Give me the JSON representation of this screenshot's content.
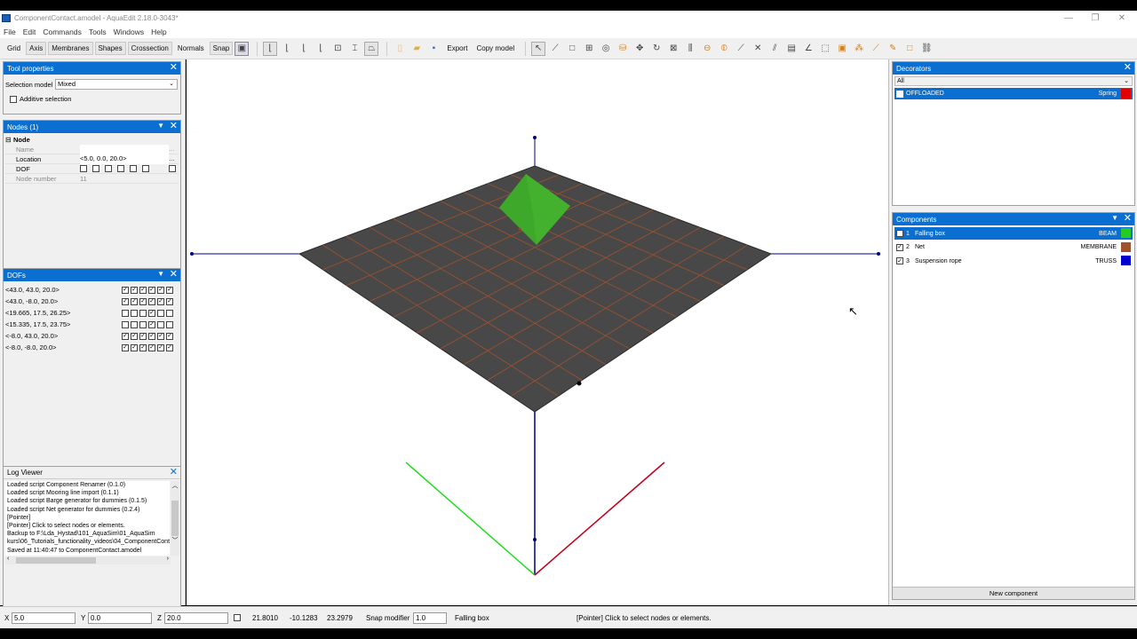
{
  "window": {
    "title": "ComponentContact.amodel - AquaEdit 2.18.0-3043*",
    "min": "—",
    "max": "❐",
    "close": "✕"
  },
  "menu": [
    "File",
    "Edit",
    "Commands",
    "Tools",
    "Windows",
    "Help"
  ],
  "toolbar": {
    "buttons": [
      "Grid",
      "Axis",
      "Membranes",
      "Shapes",
      "Crossection",
      "Normals",
      "Snap"
    ],
    "export": "Export",
    "copy_model": "Copy model"
  },
  "tool_properties": {
    "title": "Tool properties",
    "selection_model_label": "Selection model",
    "selection_model_value": "Mixed",
    "additive_selection": "Additive selection"
  },
  "nodes": {
    "title": "Nodes (1)",
    "group": "Node",
    "rows": [
      {
        "label": "Name",
        "value": ""
      },
      {
        "label": "Location",
        "value": "<5.0, 0.0, 20.0>"
      },
      {
        "label": "DOF",
        "value": ""
      },
      {
        "label": "Node number",
        "value": "11"
      }
    ]
  },
  "dofs": {
    "title": "DOFs",
    "rows": [
      {
        "label": "<43.0, 43.0, 20.0>",
        "checks": [
          true,
          true,
          true,
          true,
          true,
          true
        ]
      },
      {
        "label": "<43.0, -8.0, 20.0>",
        "checks": [
          true,
          true,
          true,
          true,
          true,
          true
        ]
      },
      {
        "label": "<19.665, 17.5, 26.25>",
        "checks": [
          false,
          false,
          false,
          true,
          false,
          false
        ]
      },
      {
        "label": "<15.335, 17.5, 23.75>",
        "checks": [
          false,
          false,
          false,
          true,
          false,
          false
        ]
      },
      {
        "label": "<-8.0, 43.0, 20.0>",
        "checks": [
          true,
          true,
          true,
          true,
          true,
          true
        ]
      },
      {
        "label": "<-8.0, -8.0, 20.0>",
        "checks": [
          true,
          true,
          true,
          true,
          true,
          true
        ]
      }
    ]
  },
  "log_viewer": {
    "title": "Log Viewer",
    "lines": [
      "Loaded script Component Renamer (0.1.0)",
      "Loaded script Mooring line import (0.1.1)",
      "Loaded script Barge generator for dummies (0.1.5)",
      "Loaded script Net generator for dummies (0.2.4)",
      "[Pointer]",
      "[Pointer] Click to select nodes or elements.",
      "Backup to F:\\Lda_Hystad\\101_AquaSim\\01_AquaSim",
      "kurs\\06_Tutorials_functionality_videos\\04_ComponentCont",
      "Saved at 11:40:47 to ComponentContact.amodel"
    ]
  },
  "decorators": {
    "title": "Decorators",
    "filter": "All",
    "items": [
      {
        "name": "OFFLOADED",
        "type": "Spring",
        "color": "#e00000",
        "checked": true
      }
    ]
  },
  "components": {
    "title": "Components",
    "items": [
      {
        "index": "1",
        "name": "Falling box",
        "type": "BEAM",
        "color": "#22cc22",
        "checked": true
      },
      {
        "index": "2",
        "name": "Net",
        "type": "MEMBRANE",
        "color": "#a0522d",
        "checked": true
      },
      {
        "index": "3",
        "name": "Suspension rope",
        "type": "TRUSS",
        "color": "#0000cc",
        "checked": true
      }
    ],
    "new_button": "New component"
  },
  "statusbar": {
    "x_label": "X",
    "x_value": "5.0",
    "y_label": "Y",
    "y_value": "0.0",
    "z_label": "Z",
    "z_value": "20.0",
    "coord1": "21.8010",
    "coord2": "-10.1283",
    "coord3": "23.2979",
    "snap_label": "Snap modifier",
    "snap_value": "1.0",
    "selection": "Falling box",
    "message": "[Pointer] Click to select nodes or elements."
  },
  "colors": {
    "accent": "#0a6fd0",
    "net": "#484848",
    "net_lines": "#a0522d",
    "box": "#3ea82a",
    "axis_x": "#c0001a",
    "axis_y": "#22dd22",
    "axis_z": "#000080"
  }
}
